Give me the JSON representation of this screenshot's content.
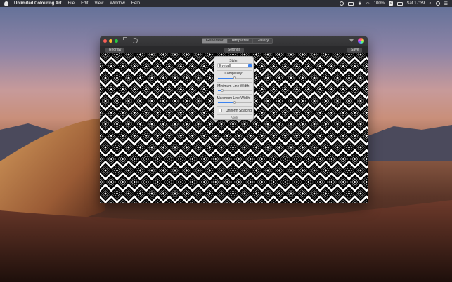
{
  "menubar": {
    "app_name": "Unlimited Colouring Art",
    "menus": [
      "File",
      "Edit",
      "View",
      "Window",
      "Help"
    ],
    "status": {
      "battery_percent": "100%",
      "battery_badge": "⚡",
      "clock": "Sat 17:39"
    },
    "icons": [
      "apple-icon",
      "cloud-icon",
      "airplay-icon",
      "bluetooth-icon",
      "wifi-icon",
      "battery-icon",
      "display-icon",
      "search-icon",
      "siri-icon",
      "notification-center-icon"
    ]
  },
  "window": {
    "tabs": [
      {
        "label": "Generator",
        "active": true
      },
      {
        "label": "Templates",
        "active": false
      },
      {
        "label": "Gallery",
        "active": false
      }
    ],
    "toolbar": {
      "redraw_label": "Redraw",
      "settings_label": "Settings",
      "save_label": "Save"
    },
    "icons": [
      "print-icon",
      "undo-icon",
      "arrow-down-icon",
      "colour-wheel-icon"
    ]
  },
  "settings_popover": {
    "style_label": "Style:",
    "style_value": "Eyeball",
    "complexity_label": "Complexity:",
    "complexity_value": 0.5,
    "min_width_label": "Minimum Line Width:",
    "min_width_value": 0.12,
    "max_width_label": "Maximum Line Width:",
    "max_width_value": 0.5,
    "uniform_label": "Uniform Spacing",
    "uniform_checked": false,
    "apply_label": "Apply"
  },
  "colors": {
    "accent": "#3b82f0",
    "close": "#fc5f57",
    "minimize": "#fdbb2e",
    "maximize": "#27c840"
  }
}
